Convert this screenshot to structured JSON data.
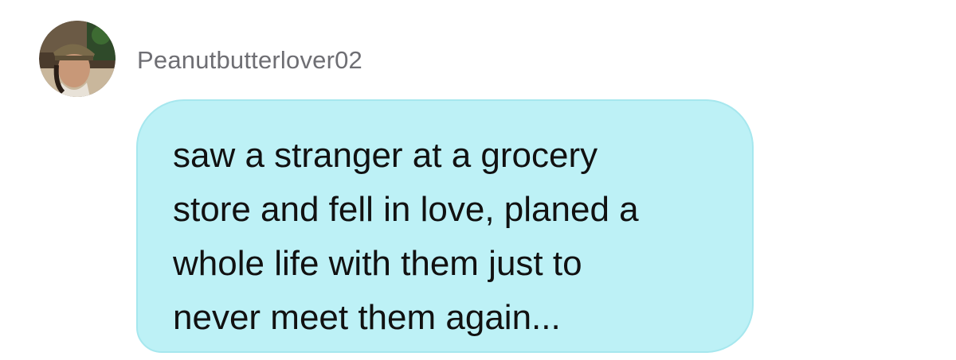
{
  "comment": {
    "author": {
      "username": "Peanutbutterlover02",
      "avatar": "user-photo-avatar"
    },
    "bubble_color": "#bdf1f6",
    "message_lines": [
      "saw a stranger at a grocery",
      "store and fell in love, planed a",
      "whole life with them just to",
      "never meet them again..."
    ]
  }
}
